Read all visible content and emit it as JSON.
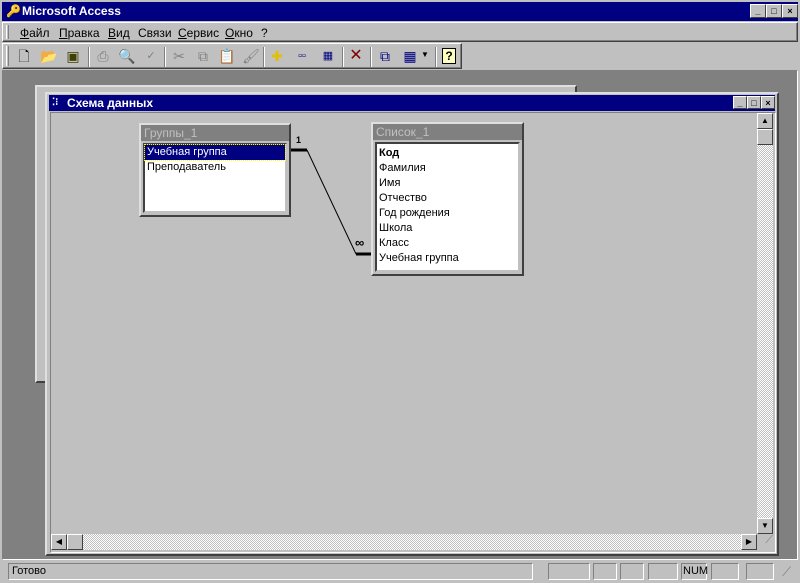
{
  "app": {
    "title": "Microsoft Access"
  },
  "menu": [
    {
      "label": "Файл",
      "key": "Ф",
      "rest": "айл"
    },
    {
      "label": "Правка",
      "key": "П",
      "rest": "равка"
    },
    {
      "label": "Вид",
      "key": "В",
      "rest": "ид"
    },
    {
      "label": "Связи",
      "key": "",
      "rest": "Связи"
    },
    {
      "label": "Сервис",
      "key": "С",
      "rest": "ервис"
    },
    {
      "label": "Окно",
      "key": "О",
      "rest": "кно"
    },
    {
      "label": "?",
      "key": "?",
      "rest": ""
    }
  ],
  "toolbar": {
    "icons": [
      "new-icon",
      "open-icon",
      "save-icon",
      "print-icon",
      "print-preview-icon",
      "spelling-icon",
      "cut-icon",
      "copy-icon",
      "paste-icon",
      "format-painter-icon",
      "show-table-icon",
      "show-direct-icon",
      "show-all-icon",
      "delete-icon",
      "relationships-icon",
      "new-object-icon",
      "help-icon"
    ]
  },
  "schema_window": {
    "title": "Схема данных"
  },
  "tables": [
    {
      "name": "Группы_1",
      "fields": [
        "Учебная группа",
        "Преподаватель"
      ],
      "selected": 0
    },
    {
      "name": "Список_1",
      "fields": [
        "Код",
        "Фамилия",
        "Имя",
        "Отчество",
        "Год рождения",
        "Школа",
        "Класс",
        "Учебная группа"
      ],
      "key": 0
    }
  ],
  "relationship": {
    "one_label": "1",
    "many_label": "∞"
  },
  "status": {
    "text": "Готово",
    "num": "NUM"
  }
}
